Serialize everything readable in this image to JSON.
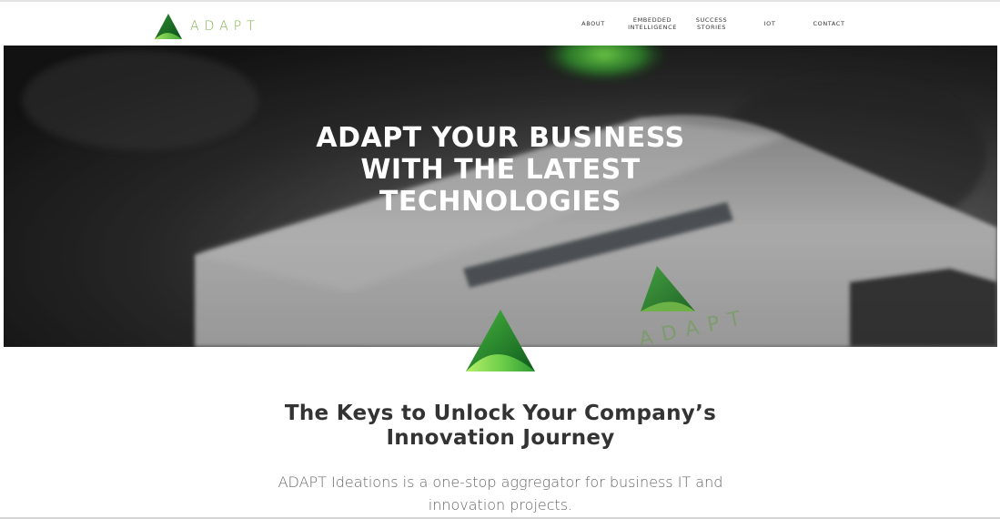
{
  "header": {
    "logo_text": "ADAPT",
    "nav": [
      {
        "line1": "ABOUT",
        "line2": ""
      },
      {
        "line1": "EMBEDDED",
        "line2": "INTELLIGENCE"
      },
      {
        "line1": "SUCCESS",
        "line2": "STORIES"
      },
      {
        "line1": "IOT",
        "line2": ""
      },
      {
        "line1": "CONTACT",
        "line2": ""
      }
    ]
  },
  "hero": {
    "title_lines": [
      "ADAPT YOUR BUSINESS",
      "WITH THE LATEST",
      "TECHNOLOGIES"
    ],
    "device_logo_text": "ADAPT"
  },
  "main": {
    "title_lines": [
      "The Keys to Unlock Your Company’s",
      "Innovation Journey"
    ],
    "description_lines": [
      "ADAPT Ideations is a one-stop aggregator for business IT and",
      "innovation projects."
    ]
  },
  "colors": {
    "brand_green": "#7bb04a",
    "dark_green": "#1f7a2a",
    "light_green": "#8bd34a"
  }
}
